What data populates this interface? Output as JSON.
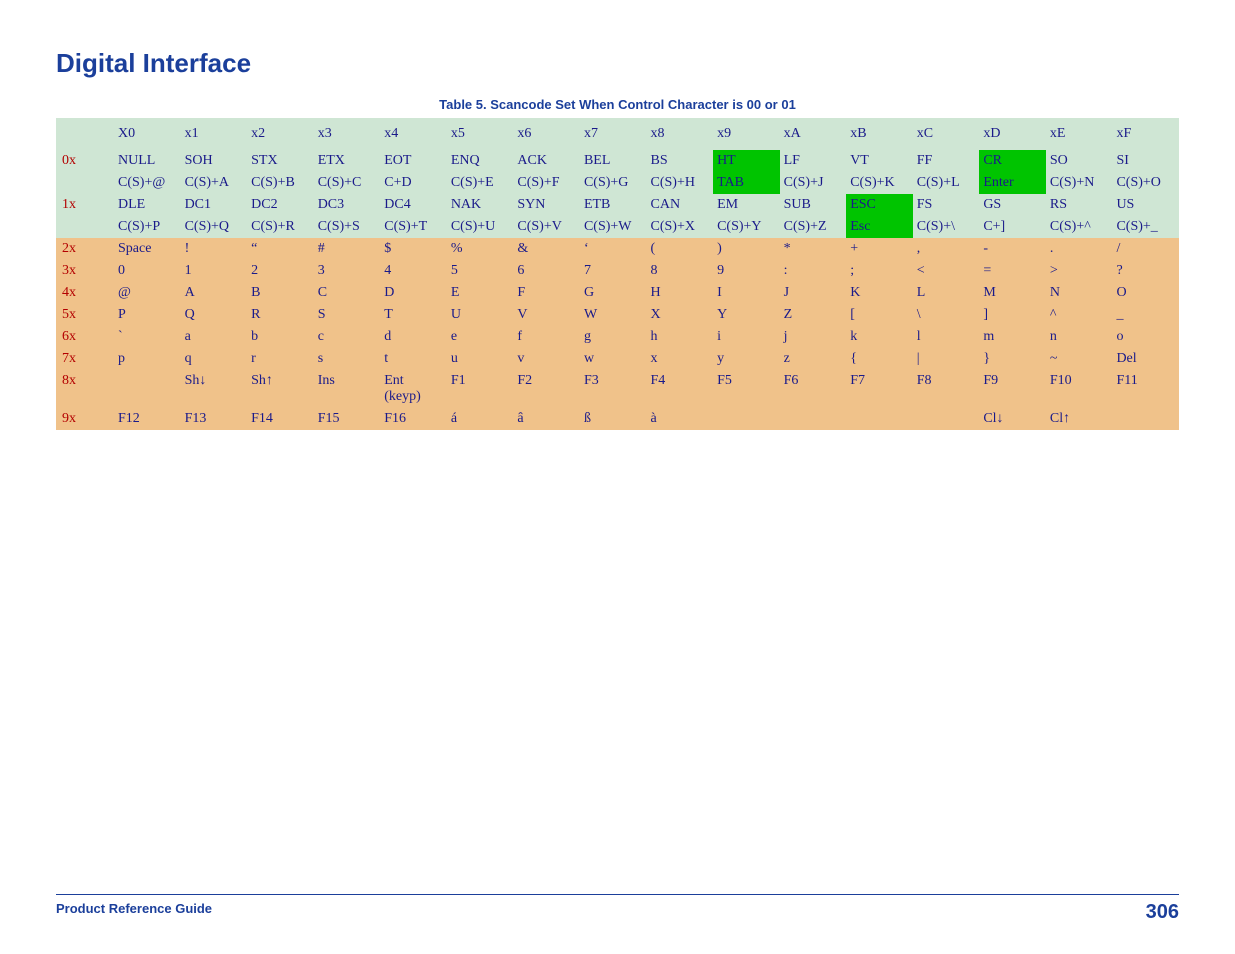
{
  "page_title": "Digital Interface",
  "table_caption": "Table 5. Scancode Set When Control Character is 00 or 01",
  "footer": {
    "left": "Product Reference Guide",
    "right": "306"
  },
  "col_headers": [
    "X0",
    "x1",
    "x2",
    "x3",
    "x4",
    "x5",
    "x6",
    "x7",
    "x8",
    "x9",
    "xA",
    "xB",
    "xC",
    "xD",
    "xE",
    "xF"
  ],
  "rows": {
    "0x": {
      "main": [
        "NULL",
        "SOH",
        "STX",
        "ETX",
        "EOT",
        "ENQ",
        "ACK",
        "BEL",
        "BS",
        "HT",
        "LF",
        "VT",
        "FF",
        "CR",
        "SO",
        "SI"
      ],
      "sub": [
        "C(S)+@",
        "C(S)+A",
        "C(S)+B",
        "C(S)+C",
        "C+D",
        "C(S)+E",
        "C(S)+F",
        "C(S)+G",
        "C(S)+H",
        "TAB",
        "C(S)+J",
        "C(S)+K",
        "C(S)+L",
        "Enter",
        "C(S)+N",
        "C(S)+O"
      ],
      "hl_main": {
        "9": "green",
        "13": "green"
      },
      "hl_sub": {
        "9": "green",
        "13": "green"
      }
    },
    "1x": {
      "main": [
        "DLE",
        "DC1",
        "DC2",
        "DC3",
        "DC4",
        "NAK",
        "SYN",
        "ETB",
        "CAN",
        "EM",
        "SUB",
        "ESC",
        "FS",
        "GS",
        "RS",
        "US"
      ],
      "sub": [
        "C(S)+P",
        "C(S)+Q",
        "C(S)+R",
        "C(S)+S",
        "C(S)+T",
        "C(S)+U",
        "C(S)+V",
        "C(S)+W",
        "C(S)+X",
        "C(S)+Y",
        "C(S)+Z",
        "Esc",
        "C(S)+\\",
        "C+]",
        "C(S)+^",
        "C(S)+_"
      ],
      "hl_main": {
        "11": "green"
      },
      "hl_sub": {
        "11": "green"
      }
    },
    "2x": [
      "Space",
      "!",
      "“",
      "#",
      "$",
      "%",
      "&",
      "‘",
      "(",
      ")",
      "*",
      "+",
      ",",
      "-",
      ".",
      "/"
    ],
    "3x": [
      "0",
      "1",
      "2",
      "3",
      "4",
      "5",
      "6",
      "7",
      "8",
      "9",
      ":",
      ";",
      "<",
      "=",
      ">",
      "?"
    ],
    "4x": [
      "@",
      "A",
      "B",
      "C",
      "D",
      "E",
      "F",
      "G",
      "H",
      "I",
      "J",
      "K",
      "L",
      "M",
      "N",
      "O"
    ],
    "5x": [
      "P",
      "Q",
      "R",
      "S",
      "T",
      "U",
      "V",
      "W",
      "X",
      "Y",
      "Z",
      "[",
      "\\",
      "]",
      "^",
      "_"
    ],
    "6x": [
      "`",
      "a",
      "b",
      "c",
      "d",
      "e",
      "f",
      "g",
      "h",
      "i",
      "j",
      "k",
      "l",
      "m",
      "n",
      "o"
    ],
    "7x": [
      "p",
      "q",
      "r",
      "s",
      "t",
      "u",
      "v",
      "w",
      "x",
      "y",
      "z",
      "{",
      "|",
      "}",
      "~",
      "Del"
    ],
    "8x": [
      "",
      "Sh↓",
      "Sh↑",
      "Ins",
      "Ent (keyp)",
      "F1",
      "F2",
      "F3",
      "F4",
      "F5",
      "F6",
      "F7",
      "F8",
      "F9",
      "F10",
      "F11"
    ],
    "9x": [
      "F12",
      "F13",
      "F14",
      "F15",
      "F16",
      "á",
      "â",
      "ß",
      "à",
      "",
      "",
      "",
      "",
      "Cl↓",
      "Cl↑",
      ""
    ]
  },
  "row_order": [
    "0x",
    "1x",
    "2x",
    "3x",
    "4x",
    "5x",
    "6x",
    "7x",
    "8x",
    "9x"
  ],
  "row_class": {
    "0x": "green",
    "1x": "green",
    "2x": "orange",
    "3x": "orange",
    "4x": "orange",
    "5x": "orange",
    "6x": "orange",
    "7x": "orange",
    "8x": "orange",
    "9x": "orange"
  }
}
